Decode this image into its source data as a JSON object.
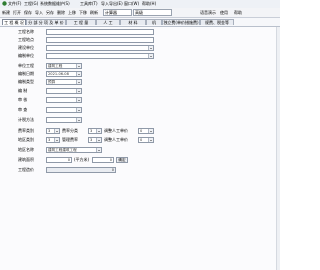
{
  "menu": [
    "文件(F)",
    "工程(G)",
    "系统数据维护(S)",
    "工具库(T)",
    "导入导出(E)",
    "窗口(W)",
    "帮助(H)"
  ],
  "toolbar": {
    "items": [
      "新建",
      "打开",
      "保存",
      "导入",
      "另存",
      "删除",
      "上移",
      "下移",
      "刷新"
    ],
    "combo1": "计算器",
    "combo2": "高级",
    "right_items": [
      "语音演示",
      "使用",
      "帮助"
    ]
  },
  "tabs": [
    "工 程 概 况",
    "分 部 分 项 及 单 价",
    "工 程 量",
    "人 工",
    "材 料",
    "机",
    "独立费(单价措施费)",
    "规费、税金等"
  ],
  "form": {
    "project_name_label": "工程名称",
    "project_name_value": "",
    "project_location_label": "工程地点",
    "project_location_value": "",
    "construction_unit_label": "建设单位",
    "construction_unit_value": "",
    "prepare_unit_label": "编制单位",
    "prepare_unit_value": "",
    "nature_label": "单位工程",
    "nature_value": "建筑工程",
    "prepare_date_label": "编制日期",
    "prepare_date_value": "2021-06-08",
    "prepare_type_label": "编制类型",
    "prepare_type_value": "预算",
    "prepared_by_label": "编 制",
    "prepared_by_value": "",
    "reviewed_by_label": "审 核",
    "reviewed_by_value": "",
    "checked_by_label": "审 查",
    "checked_by_value": "",
    "tax_method_label": "计税方法",
    "tax_method_value": "",
    "rate1_label": "费率类别",
    "rate1_value": "3",
    "rate1_mid_label": "费率分类",
    "rate1_mid_value": "3",
    "rate1_right_label": "调整人工单价",
    "rate1_right_value": "0",
    "rate2_label": "地区类别",
    "rate2_value": "3",
    "rate2_mid_label": "管理费率",
    "rate2_mid_value": "3",
    "rate2_right_label": "调整人工单价",
    "rate2_right_value": "0",
    "region_label": "地区名称",
    "region_value": "建筑工程建筑工程",
    "area_label": "建筑面积",
    "area_value": "0",
    "area_unit": "(平方米)",
    "area_mid_value": "0",
    "area_button": "确定",
    "amount_label": "工程造价",
    "amount_value": "0"
  }
}
